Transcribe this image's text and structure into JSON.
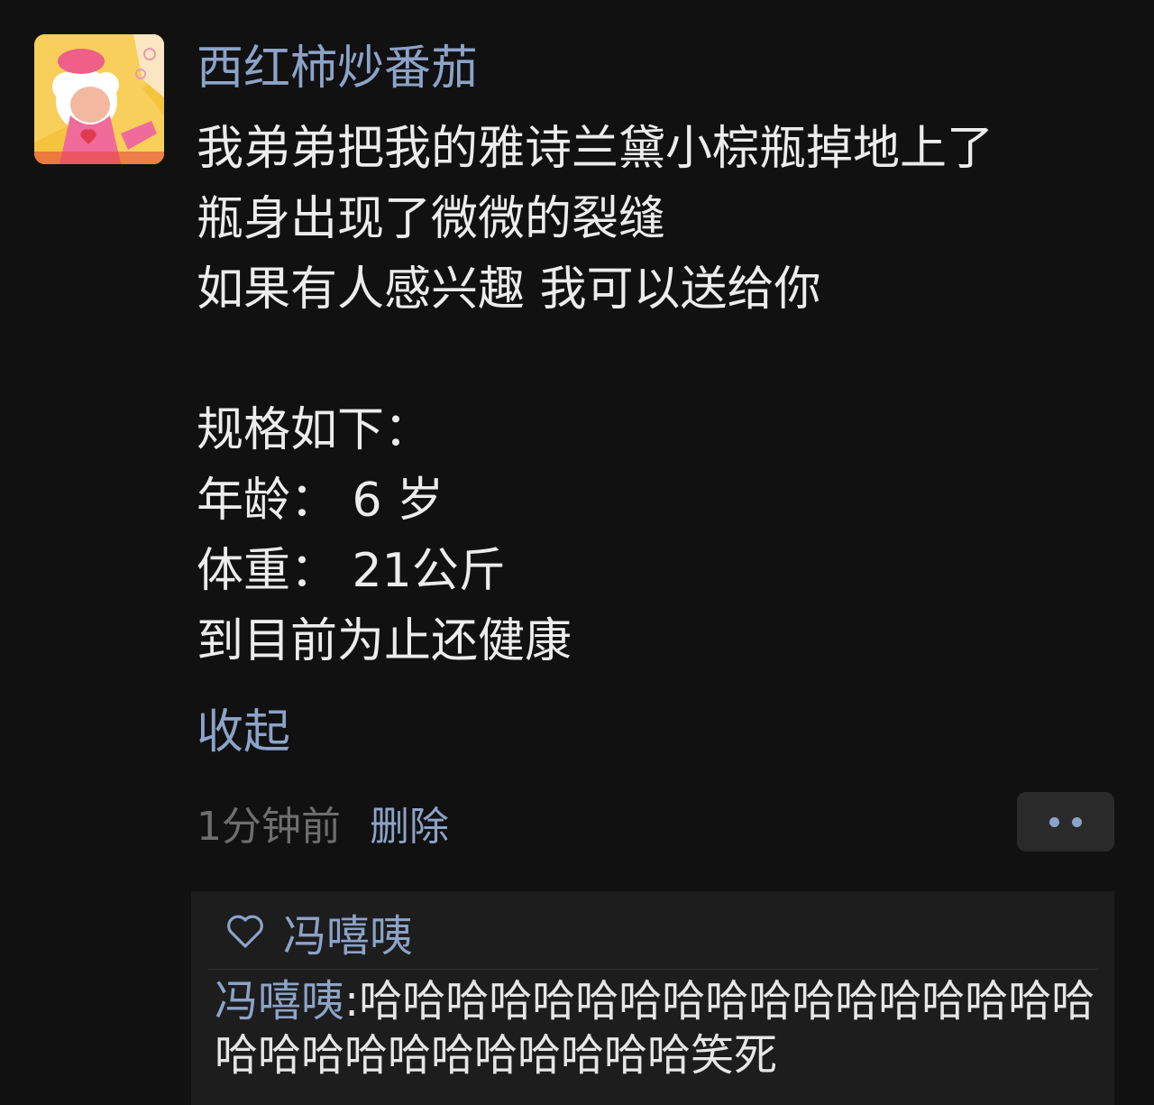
{
  "post": {
    "username": "西红柿炒番茄",
    "lines": [
      "我弟弟把我的雅诗兰黛小棕瓶掉地上了",
      "瓶身出现了微微的裂缝",
      "如果有人感兴趣 我可以送给你",
      "",
      "规格如下：",
      "年龄：  6 岁",
      "体重：  21公斤",
      "到目前为止还健康"
    ],
    "collapse_label": "收起",
    "timestamp": "1分钟前",
    "delete_label": "删除",
    "more_icon": "more-dots-icon"
  },
  "interactions": {
    "like_icon": "heart-outline-icon",
    "likes": "冯嘻咦",
    "comments": [
      {
        "author": "冯嘻咦",
        "separator": ":",
        "text": "哈哈哈哈哈哈哈哈哈哈哈哈哈哈哈哈哈哈哈哈哈哈哈哈哈哈哈哈笑死"
      }
    ]
  },
  "colors": {
    "background": "#111111",
    "link": "#8ca3c9",
    "text": "#ececec",
    "muted": "#6e6e6e",
    "panel": "#1d1d1d"
  }
}
